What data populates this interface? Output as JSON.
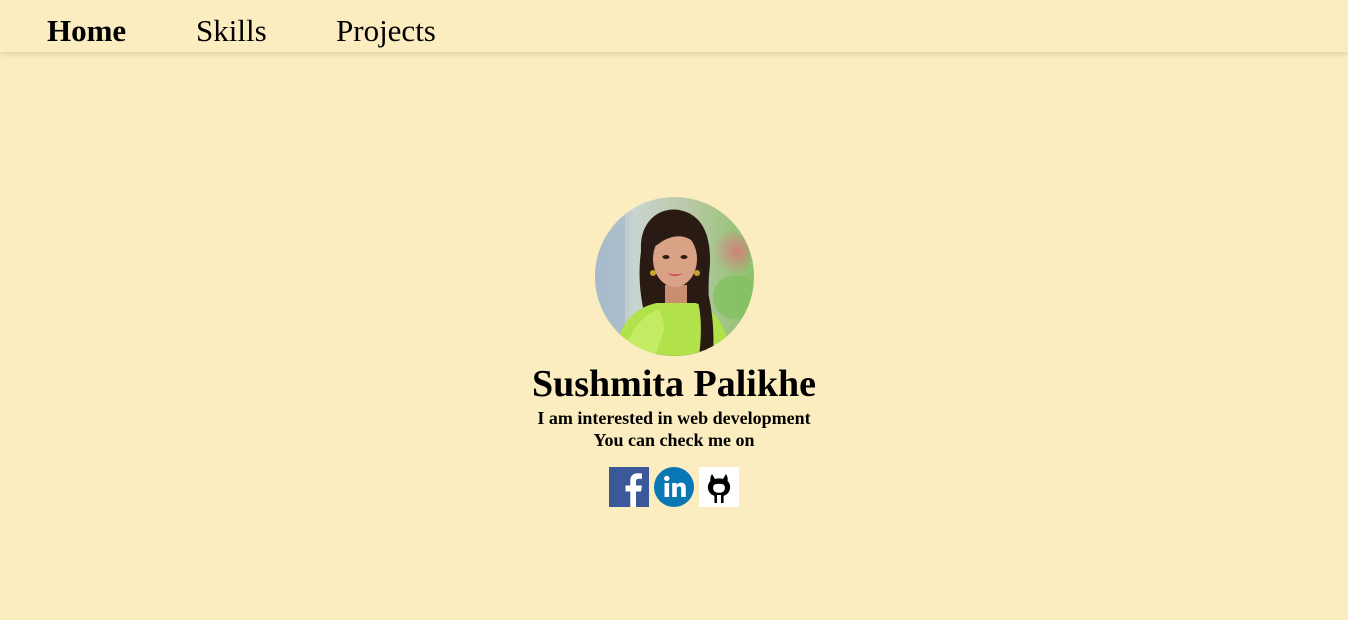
{
  "nav": {
    "home": "Home",
    "skills": "Skills",
    "projects": "Projects"
  },
  "profile": {
    "name": "Sushmita Palikhe",
    "tagline": "I am interested in web development",
    "check_me": "You can check me on"
  },
  "socials": [
    {
      "icon": "facebook-icon"
    },
    {
      "icon": "linkedin-icon"
    },
    {
      "icon": "github-icon"
    }
  ],
  "colors": {
    "background": "#fbedbf",
    "facebook": "#3b5998",
    "linkedin": "#0a77b5"
  }
}
